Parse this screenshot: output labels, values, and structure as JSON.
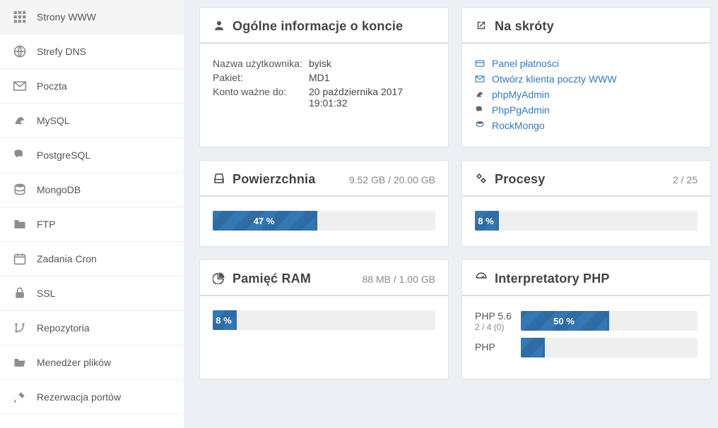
{
  "sidebar": {
    "items": [
      {
        "label": "Strony WWW",
        "icon": "grid-icon"
      },
      {
        "label": "Strefy DNS",
        "icon": "globe-icon"
      },
      {
        "label": "Poczta",
        "icon": "envelope-icon"
      },
      {
        "label": "MySQL",
        "icon": "mysql-icon"
      },
      {
        "label": "PostgreSQL",
        "icon": "postgres-icon"
      },
      {
        "label": "MongoDB",
        "icon": "database-icon"
      },
      {
        "label": "FTP",
        "icon": "folder-icon"
      },
      {
        "label": "Zadania Cron",
        "icon": "calendar-icon"
      },
      {
        "label": "SSL",
        "icon": "lock-icon"
      },
      {
        "label": "Repozytoria",
        "icon": "branch-icon"
      },
      {
        "label": "Menedżer plików",
        "icon": "folder-open-icon"
      },
      {
        "label": "Rezerwacja portów",
        "icon": "tools-icon"
      }
    ]
  },
  "account_info": {
    "title": "Ogólne informacje o koncie",
    "rows": {
      "username_label": "Nazwa użytkownika:",
      "username_value": "byisk",
      "package_label": "Pakiet:",
      "package_value": "MD1",
      "valid_until_label": "Konto ważne do:",
      "valid_until_value": "20 października 2017 19:01:32"
    }
  },
  "shortcuts": {
    "title": "Na skróty",
    "items": [
      {
        "label": "Panel płatności",
        "icon": "credit-card-icon"
      },
      {
        "label": "Otwórz klienta poczty WWW",
        "icon": "envelope-icon"
      },
      {
        "label": "phpMyAdmin",
        "icon": "mysql-icon"
      },
      {
        "label": "PhpPgAdmin",
        "icon": "postgres-icon"
      },
      {
        "label": "RockMongo",
        "icon": "database-icon"
      }
    ]
  },
  "disk": {
    "title": "Powierzchnia",
    "meta": "9.52 GB / 20.00 GB",
    "percent_label": "47 %",
    "percent": 47
  },
  "processes": {
    "title": "Procesy",
    "meta": "2 / 25",
    "percent_label": "8 %",
    "percent": 8
  },
  "ram": {
    "title": "Pamięć RAM",
    "meta": "88 MB / 1.00 GB",
    "percent_label": "8 %",
    "percent": 8
  },
  "php": {
    "title": "Interpretatory PHP",
    "rows": [
      {
        "version": "PHP 5.6",
        "count": "2 / 4 (0)",
        "percent": 50,
        "percent_label": "50 %"
      },
      {
        "version": "PHP",
        "count": "",
        "percent": 3,
        "percent_label": ""
      }
    ]
  }
}
